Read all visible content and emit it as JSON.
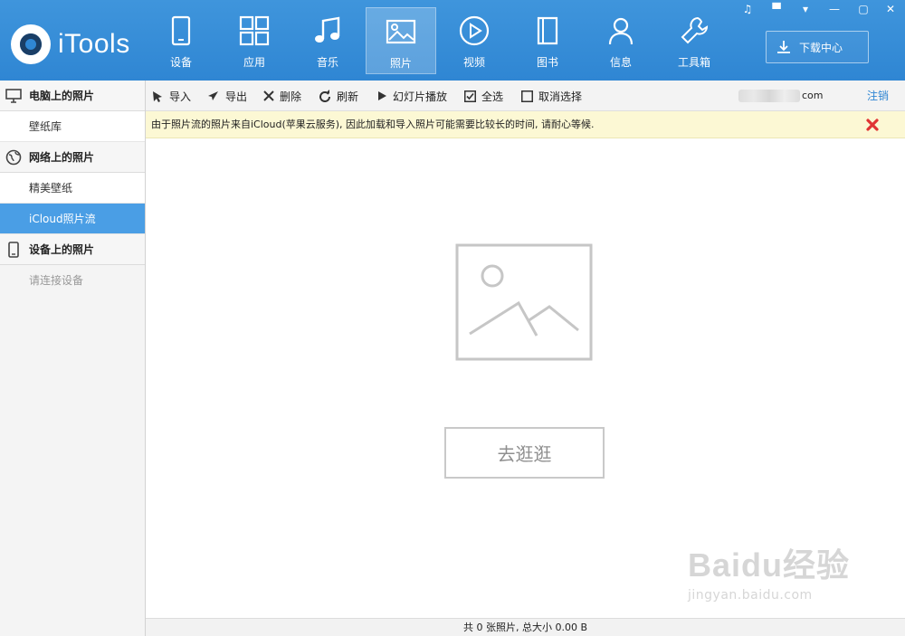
{
  "app": {
    "name": "iTools"
  },
  "nav": [
    {
      "id": "device",
      "label": "设备",
      "icon": "device-icon"
    },
    {
      "id": "apps",
      "label": "应用",
      "icon": "apps-icon"
    },
    {
      "id": "music",
      "label": "音乐",
      "icon": "music-icon"
    },
    {
      "id": "photos",
      "label": "照片",
      "icon": "photo-icon",
      "active": true
    },
    {
      "id": "video",
      "label": "视频",
      "icon": "video-icon"
    },
    {
      "id": "books",
      "label": "图书",
      "icon": "book-icon"
    },
    {
      "id": "info",
      "label": "信息",
      "icon": "user-icon"
    },
    {
      "id": "tools",
      "label": "工具箱",
      "icon": "wrench-icon"
    }
  ],
  "download_center": {
    "label": "下载中心"
  },
  "sidebar": {
    "sections": [
      {
        "title": "电脑上的照片",
        "icon": "monitor-icon",
        "items": [
          {
            "label": "壁纸库"
          }
        ]
      },
      {
        "title": "网络上的照片",
        "icon": "globe-icon",
        "items": [
          {
            "label": "精美壁纸"
          },
          {
            "label": "iCloud照片流",
            "active": true
          }
        ]
      },
      {
        "title": "设备上的照片",
        "icon": "phone-icon",
        "items": [
          {
            "label": "请连接设备",
            "disabled": true
          }
        ]
      }
    ]
  },
  "toolbar": {
    "import": "导入",
    "export": "导出",
    "delete": "删除",
    "refresh": "刷新",
    "slideshow": "幻灯片播放",
    "select_all": "全选",
    "deselect": "取消选择",
    "account_suffix": "com",
    "logout": "注销"
  },
  "notice": {
    "text": "由于照片流的照片来自iCloud(苹果云服务), 因此加载和导入照片可能需要比较长的时间, 请耐心等候."
  },
  "empty_state": {
    "button": "去逛逛"
  },
  "status": {
    "text": "共 0 张照片, 总大小 0.00 B"
  },
  "watermark": {
    "title": "Baidu经验",
    "url": "jingyan.baidu.com"
  },
  "colors": {
    "header_blue": "#2f86d3",
    "active_item": "#4a9ee5",
    "notice_bg": "#fcf8d4",
    "close_red": "#e03434"
  }
}
